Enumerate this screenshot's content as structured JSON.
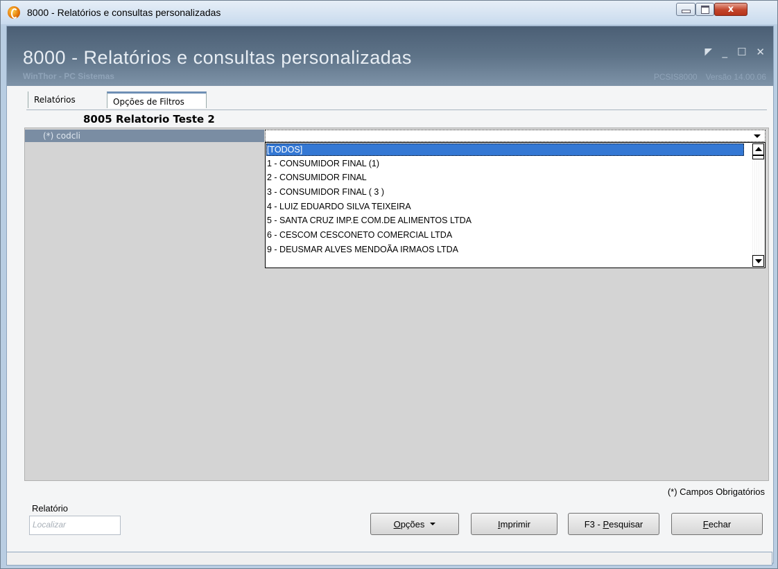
{
  "window": {
    "title": "8000 - Relatórios e consultas personalizadas",
    "controls": {
      "close": "x"
    }
  },
  "header": {
    "title": "8000 - Relatórios e consultas personalizadas",
    "subtitle": "WinThor - PC Sistemas",
    "code": "PCSIS8000",
    "version": "Versão 14.00.06",
    "icons": [
      "restore-icon",
      "minimize-icon",
      "maximize-icon",
      "close-icon"
    ]
  },
  "tabs": [
    {
      "label": "Relatórios"
    },
    {
      "label": "Opções de Filtros"
    }
  ],
  "report_name": "8005 Relatorio Teste 2",
  "filter": {
    "label": "(*) codcli",
    "value": ""
  },
  "dropdown": {
    "items": [
      "[TODOS]",
      "1 - CONSUMIDOR FINAL (1)",
      "2 - CONSUMIDOR FINAL",
      "3 - CONSUMIDOR FINAL ( 3 )",
      "4 - LUIZ EDUARDO SILVA TEIXEIRA",
      "5 - SANTA CRUZ IMP.E COM.DE ALIMENTOS LTDA",
      "6 - CESCOM CESCONETO COMERCIAL LTDA",
      "9 - DEUSMAR ALVES MENDOÃA IRMAOS LTDA"
    ],
    "selected_index": 0
  },
  "footer": {
    "required_note": "(*) Campos Obrigatórios",
    "report_label": "Relatório",
    "search_placeholder": "Localizar",
    "buttons": {
      "options_prefix": "",
      "options_u": "O",
      "options_rest": "pções",
      "print_u": "I",
      "print_rest": "mprimir",
      "search_prefix": "F3 - ",
      "search_u": "P",
      "search_rest": "esquisar",
      "close_u": "F",
      "close_rest": "echar"
    }
  },
  "colors": {
    "header_bg": "#5e7388",
    "selection": "#3478d4",
    "filter_label_bg": "#7a8da3",
    "close_button": "#c2442a"
  }
}
